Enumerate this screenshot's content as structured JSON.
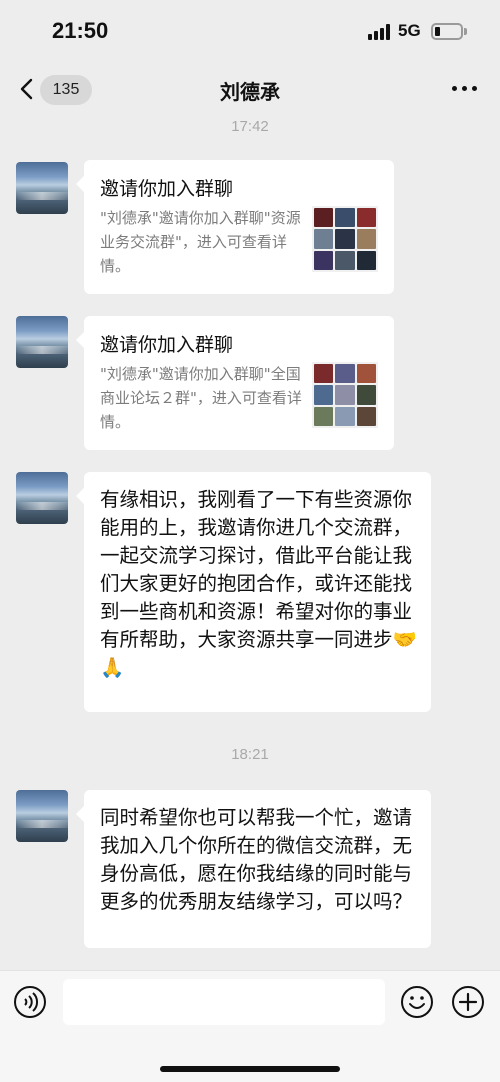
{
  "status_bar": {
    "time": "21:50",
    "network": "5G"
  },
  "header": {
    "back_badge": "135",
    "title": "刘德承"
  },
  "messages": [
    {
      "timestamp": "17:42"
    },
    {
      "type": "group_invite",
      "title": "邀请你加入群聊",
      "description": "\"刘德承\"邀请你加入群聊\"资源业务交流群\"，进入可查看详情。"
    },
    {
      "type": "group_invite",
      "title": "邀请你加入群聊",
      "description": "\"刘德承\"邀请你加入群聊\"全国商业论坛２群\"，进入可查看详情。"
    },
    {
      "type": "text",
      "text": "有缘相识，我刚看了一下有些资源你能用的上，我邀请你进几个交流群，一起交流学习探讨，借此平台能让我们大家更好的抱团合作，或许还能找到一些商机和资源！希望对你的事业有所帮助，大家资源共享一同进步🤝🙏"
    },
    {
      "timestamp": "18:21"
    },
    {
      "type": "text",
      "text": "同时希望你也可以帮我一个忙，邀请我加入几个你所在的微信交流群，无身份高低，愿在你我结缘的同时能与更多的优秀朋友结缘学习，可以吗？"
    }
  ],
  "input_bar": {
    "voice_icon": "voice-icon",
    "emoji_icon": "emoji-icon",
    "plus_icon": "plus-icon",
    "input_value": ""
  },
  "colors": {
    "background": "#ededed",
    "bubble": "#ffffff",
    "timestamp": "#a9a9a9",
    "card_desc": "#7c7c7c"
  }
}
